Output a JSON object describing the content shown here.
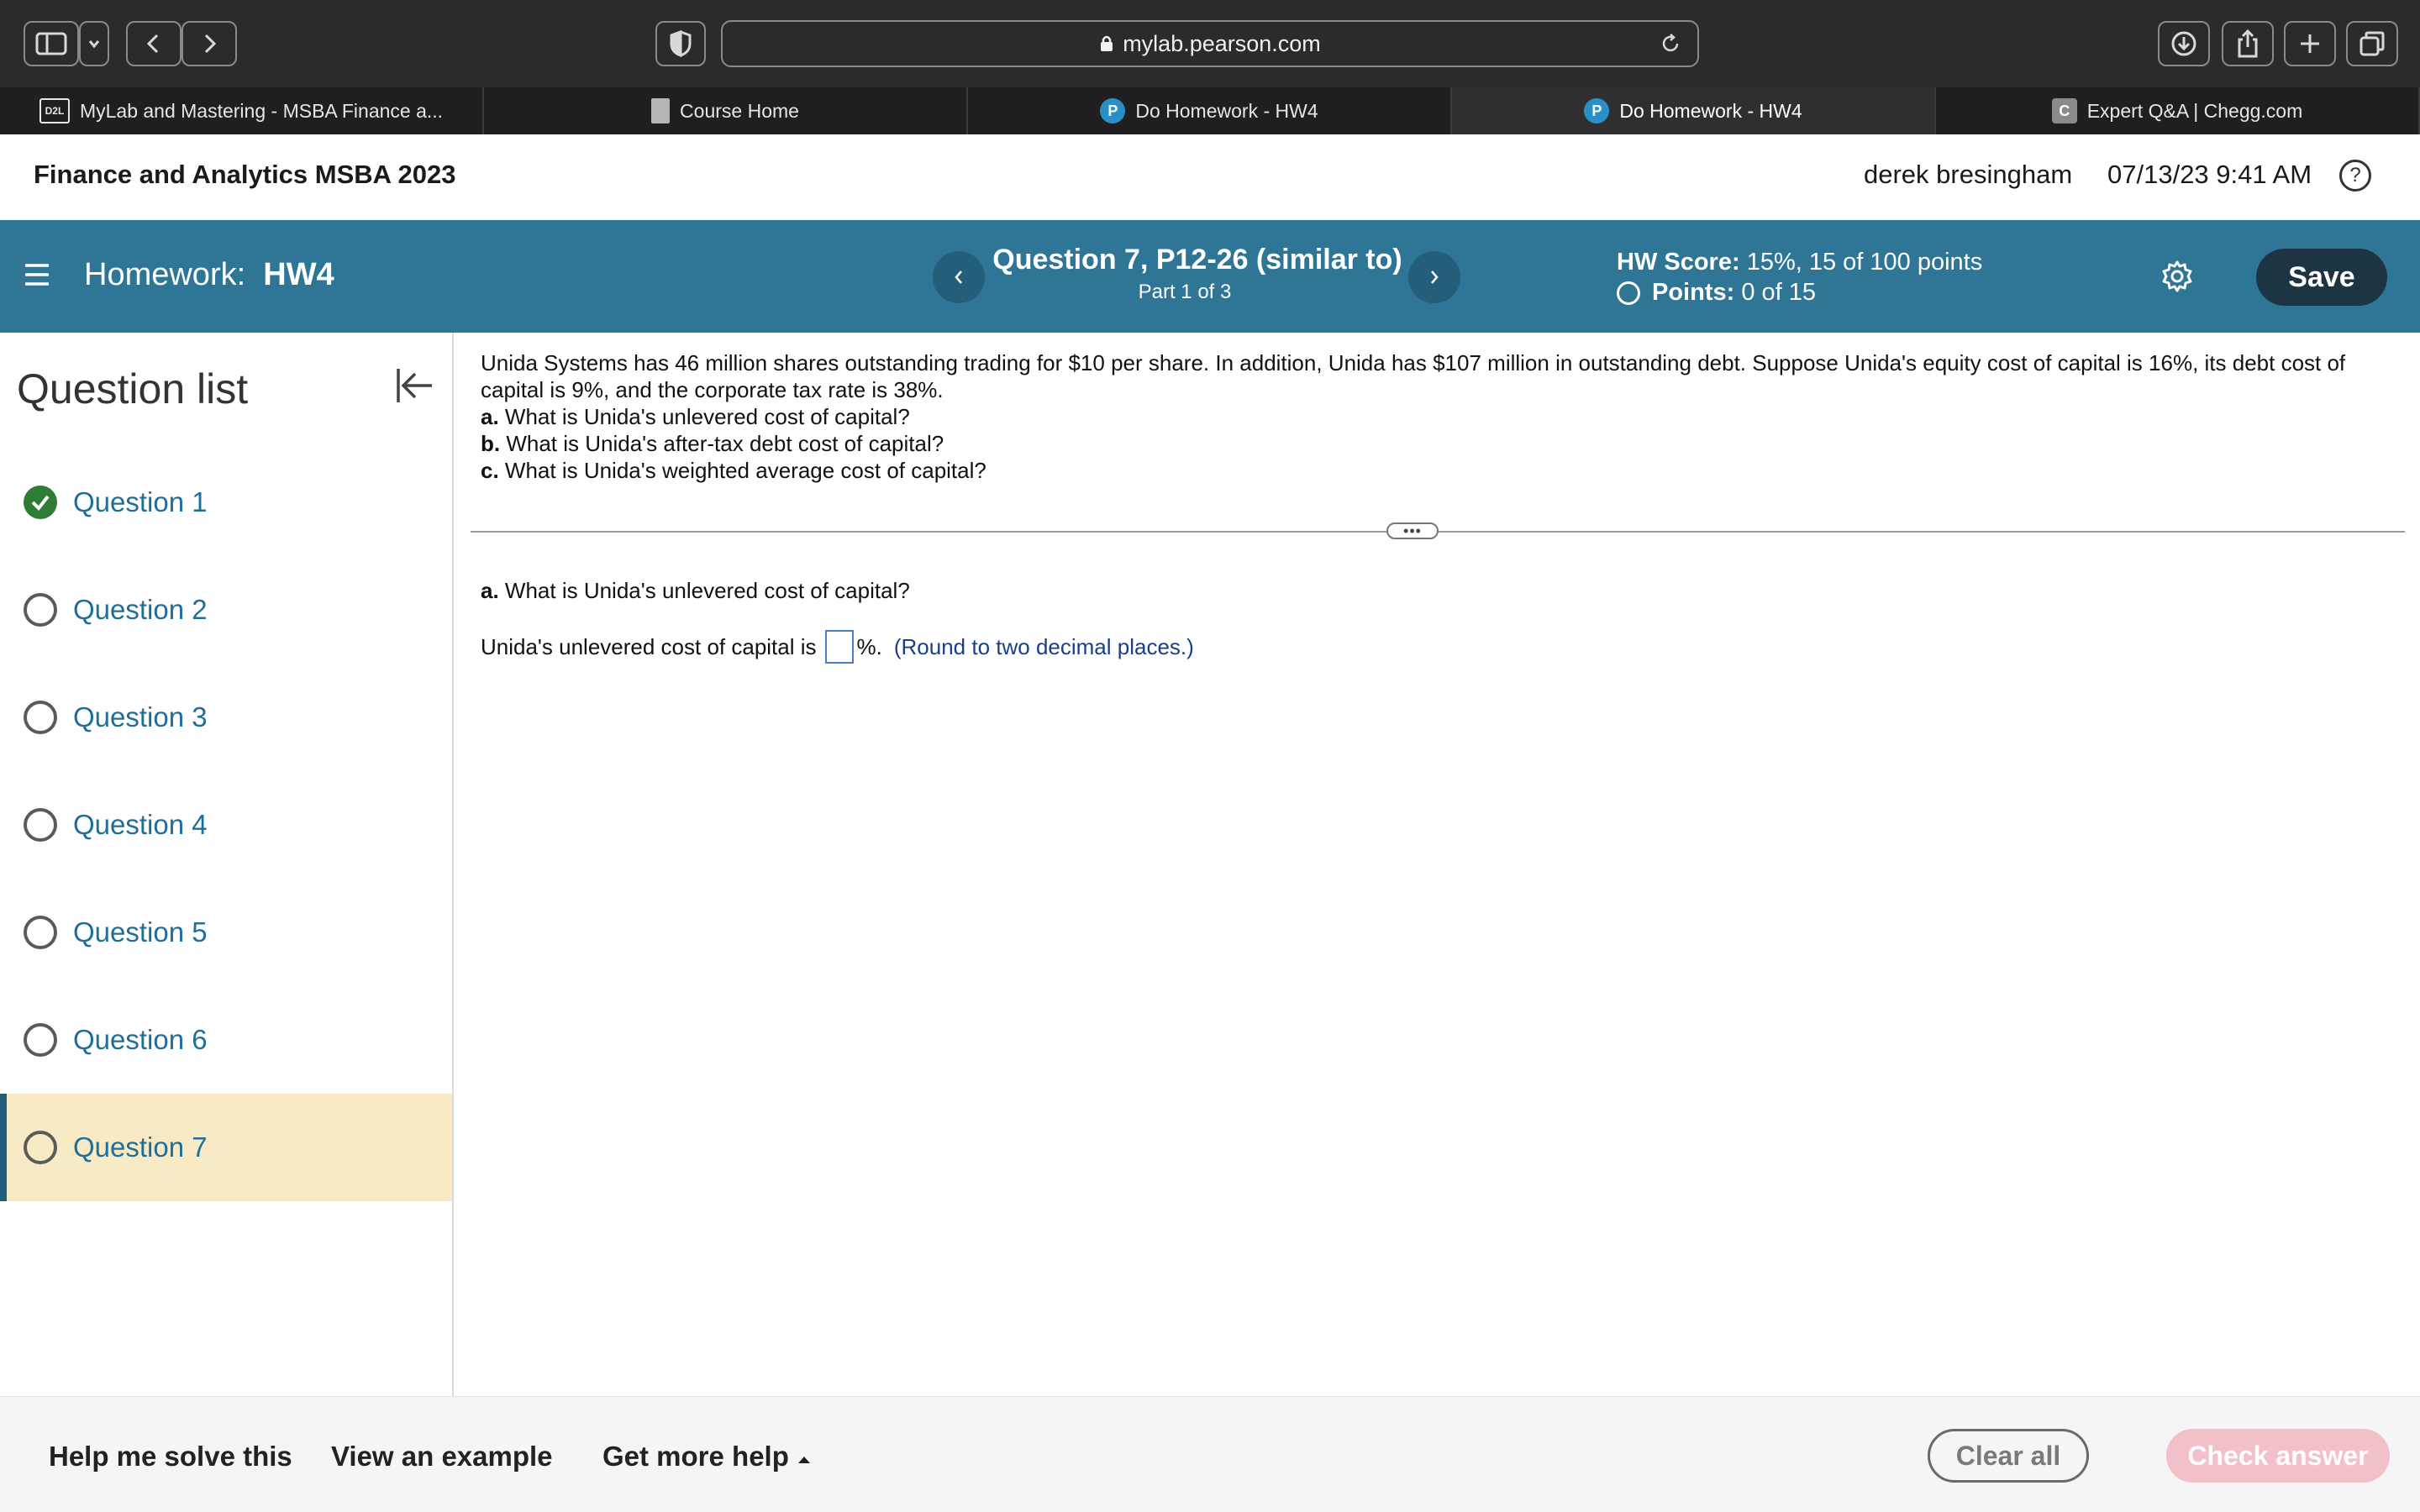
{
  "browser": {
    "url": "mylab.pearson.com",
    "tabs": [
      {
        "label": "MyLab and Mastering - MSBA Finance a...",
        "favicon": "d2l-icon",
        "fav_text": "D2L",
        "active": false
      },
      {
        "label": "Course Home",
        "favicon": "book-icon",
        "fav_text": "",
        "active": false
      },
      {
        "label": "Do Homework - HW4",
        "favicon": "pearson-icon",
        "fav_text": "P",
        "active": false
      },
      {
        "label": "Do Homework - HW4",
        "favicon": "pearson-icon",
        "fav_text": "P",
        "active": true
      },
      {
        "label": "Expert Q&A | Chegg.com",
        "favicon": "chegg-icon",
        "fav_text": "C",
        "active": false
      }
    ]
  },
  "header": {
    "course_title": "Finance and Analytics MSBA 2023",
    "user_name": "derek bresingham",
    "datetime": "07/13/23 9:41 AM"
  },
  "hw_bar": {
    "homework_label": "Homework:",
    "homework_name": "HW4",
    "question_title": "Question 7, P12-26 (similar to)",
    "part_label": "Part 1 of 3",
    "hw_score_label": "HW Score:",
    "hw_score_value": "15%, 15 of 100 points",
    "points_label": "Points:",
    "points_value": "0 of 15",
    "save_label": "Save"
  },
  "sidebar": {
    "heading": "Question list",
    "items": [
      {
        "label": "Question 1",
        "status": "complete"
      },
      {
        "label": "Question 2",
        "status": "incomplete"
      },
      {
        "label": "Question 3",
        "status": "incomplete"
      },
      {
        "label": "Question 4",
        "status": "incomplete"
      },
      {
        "label": "Question 5",
        "status": "incomplete"
      },
      {
        "label": "Question 6",
        "status": "incomplete"
      },
      {
        "label": "Question 7",
        "status": "current"
      }
    ]
  },
  "problem": {
    "intro": "Unida Systems has 46 million shares outstanding trading for $10 per share. In addition, Unida has $107 million in outstanding debt. Suppose Unida's equity cost of capital is 16%, its debt cost of capital is 9%, and the corporate tax rate is 38%.",
    "parts": [
      {
        "letter": "a.",
        "text": " What is Unida's unlevered cost of capital?"
      },
      {
        "letter": "b.",
        "text": " What is Unida's after-tax debt cost of capital?"
      },
      {
        "letter": "c.",
        "text": " What is Unida's weighted average cost of capital?"
      }
    ]
  },
  "current_part": {
    "letter": "a.",
    "text": " What is Unida's unlevered cost of capital?",
    "answer_prefix": "Unida's unlevered cost of capital is",
    "answer_value": "",
    "answer_suffix": "%.",
    "hint": "(Round to two decimal places.)"
  },
  "footer": {
    "help_solve": "Help me solve this",
    "view_example": "View an example",
    "more_help": "Get more help",
    "clear_all": "Clear all",
    "check_answer": "Check answer"
  },
  "colors": {
    "hw_bar": "#2f7596",
    "save_button": "#1d3444",
    "current_question_bg": "#f8eac4",
    "question_link": "#1f6f9a",
    "complete_check": "#2e7d32",
    "check_answer_disabled": "#f2c0c9"
  }
}
